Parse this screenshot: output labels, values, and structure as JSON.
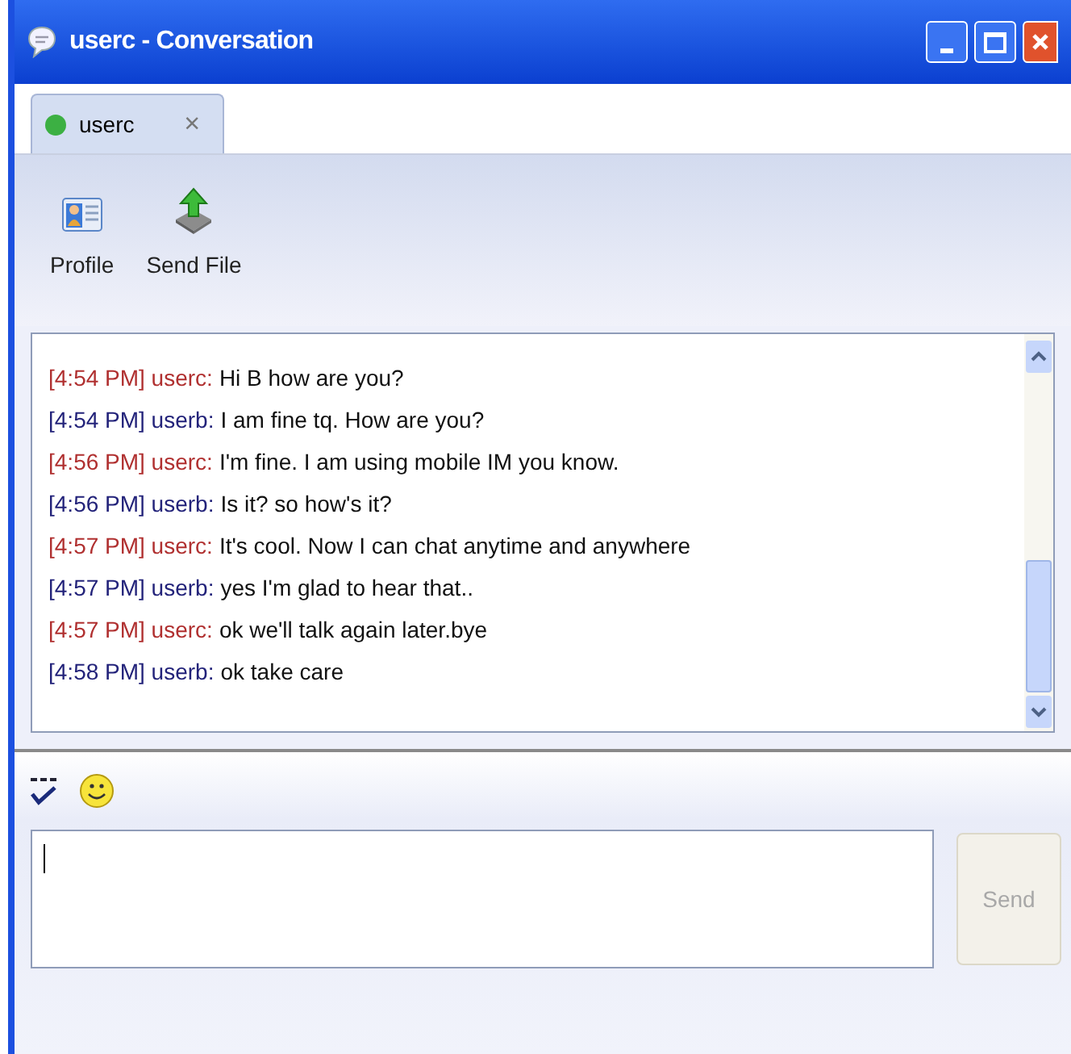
{
  "window": {
    "title": "userc - Conversation"
  },
  "tabs": [
    {
      "label": "userc",
      "selected": true,
      "color": "#3cb043",
      "close": "×"
    }
  ],
  "toolbar": [
    {
      "kind": "profile",
      "label": "Profile"
    },
    {
      "kind": "send_file",
      "label": "Send File"
    }
  ],
  "messages": [
    {
      "time": "[4:54 PM]",
      "sender": "userc:",
      "text": "Hi B how are you?",
      "color": "#b03030"
    },
    {
      "time": "[4:54 PM]",
      "sender": "userb:",
      "text": "I am fine tq. How are you?",
      "color": "#23237a"
    },
    {
      "time": "[4:56 PM]",
      "sender": "userc:",
      "text": "I'm fine. I am using mobile IM you know.",
      "color": "#b03030"
    },
    {
      "time": "[4:56 PM]",
      "sender": "userb:",
      "text": "Is it? so how's it?",
      "color": "#23237a"
    },
    {
      "time": "[4:57 PM]",
      "sender": "userc:",
      "text": "It's cool. Now I can chat anytime and anywhere",
      "color": "#b03030"
    },
    {
      "time": "[4:57 PM]",
      "sender": "userb:",
      "text": "yes I'm glad to hear that..",
      "color": "#23237a"
    },
    {
      "time": "[4:57 PM]",
      "sender": "userc:",
      "text": "ok we'll talk again later.bye",
      "color": "#b03030"
    },
    {
      "time": "[4:58 PM]",
      "sender": "userb:",
      "text": "ok take care",
      "color": "#23237a"
    }
  ],
  "send_button": {
    "label": "Send",
    "disabled": true
  }
}
